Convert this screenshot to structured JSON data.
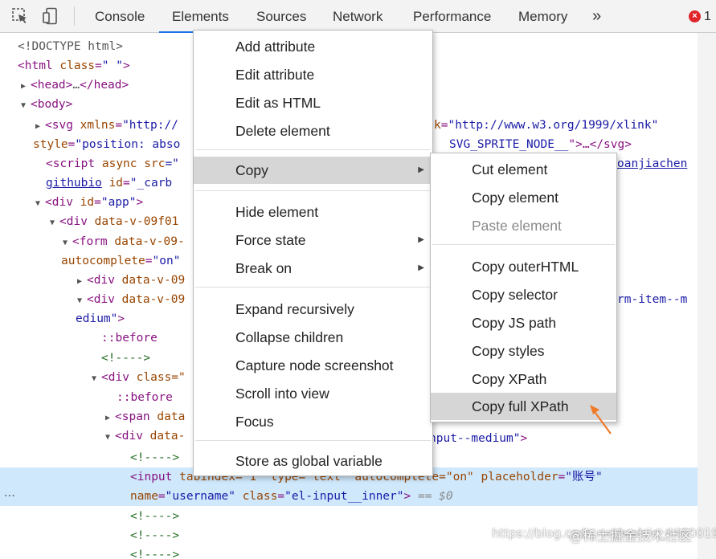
{
  "toolbar": {
    "icons": [
      "inspect-icon",
      "device-toolbar-icon"
    ],
    "tabs": [
      {
        "label": "Console"
      },
      {
        "label": "Elements"
      },
      {
        "label": "Sources"
      },
      {
        "label": "Network"
      },
      {
        "label": "Performance"
      },
      {
        "label": "Memory"
      }
    ],
    "more": "»",
    "error_badge": "×",
    "error_count": "1"
  },
  "tree": {
    "doctype": "<!DOCTYPE html>",
    "html_tag": "html",
    "html_class_attr": "class",
    "html_class_val": "\" \"",
    "head": "head",
    "ellipsis": "…",
    "body": "body",
    "svg_tag": "svg",
    "svg_attr": "xmlns",
    "svg_val": "\"http://",
    "svg_xlink_attr": "k",
    "svg_xlink_val": "\"http://www.w3.org/1999/xlink\"",
    "style_attr": "style",
    "style_val": "\"position: abso",
    "sprite": "SVG_SPRITE_NODE__",
    "svg_close": "\">…</svg>",
    "script_tag": "script",
    "script_attrs": "async src",
    "script_val": "=\"",
    "script_link": "oanjiachen",
    "githubio": "githubio",
    "id_attr": "id",
    "id_val": "\"_carb",
    "div_app_attr": "id",
    "div_app_val": "\"app\"",
    "div1": "data-v-09f01",
    "form": "data-v-09-",
    "autocomplete_attr": "autocomplete",
    "autocomplete_val": "\"on\"",
    "div2": "data-v-09",
    "div3": "data-v-09",
    "form_item_tail": "rm-item--m",
    "edium": "edium\"",
    "before": "::before",
    "comment": "<!---->",
    "div_class": "class=\"",
    "span_data": "data",
    "div_data": "data-",
    "input_medium": "nput--medium\"",
    "input_tag": "input",
    "input_attrs": "tabindex=\"1\" type=\"text\" autocomplete=\"on\"",
    "placeholder_attr": "placeholder",
    "placeholder_val": "\"账号\"",
    "name_attr": "name",
    "name_val": "\"username\"",
    "class_attr": "class",
    "class_val": "\"el-input__inner\"",
    "eq_ref": "== $0",
    "dots": "···"
  },
  "menu": {
    "items": [
      {
        "label": "Add attribute"
      },
      {
        "label": "Edit attribute"
      },
      {
        "label": "Edit as HTML"
      },
      {
        "label": "Delete element"
      },
      {
        "label": "Copy",
        "submenu": true
      },
      {
        "label": "Hide element"
      },
      {
        "label": "Force state",
        "submenu": true
      },
      {
        "label": "Break on",
        "submenu": true
      },
      {
        "label": "Expand recursively"
      },
      {
        "label": "Collapse children"
      },
      {
        "label": "Capture node screenshot"
      },
      {
        "label": "Scroll into view"
      },
      {
        "label": "Focus"
      },
      {
        "label": "Store as global variable"
      }
    ],
    "submenu_arrow": "▶"
  },
  "copy_menu": {
    "items": [
      {
        "label": "Cut element"
      },
      {
        "label": "Copy element"
      },
      {
        "label": "Paste element",
        "disabled": true
      },
      {
        "label": "Copy outerHTML"
      },
      {
        "label": "Copy selector"
      },
      {
        "label": "Copy JS path"
      },
      {
        "label": "Copy styles"
      },
      {
        "label": "Copy XPath"
      },
      {
        "label": "Copy full XPath",
        "highlighted": true
      }
    ]
  },
  "watermark": {
    "site": "@稀土掘金技术社区",
    "url": "https://blog.csdn.net/weixin_44600193"
  },
  "colors": {
    "tag": "#881280",
    "attr": "#994500",
    "value": "#1a1aa6",
    "comment": "#236e25",
    "selection": "#cfe8fc",
    "accent": "#1a73e8",
    "pointer_arrow": "#f07a2a"
  }
}
